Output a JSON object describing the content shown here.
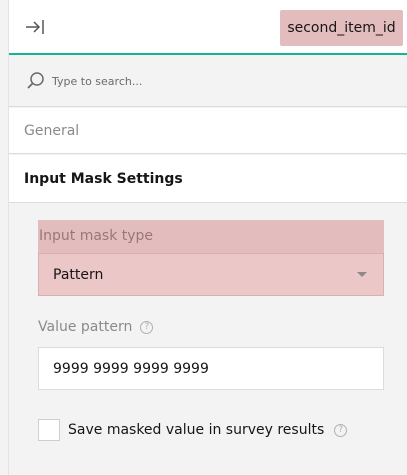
{
  "header": {
    "collapse_icon": "collapse-right-icon",
    "item_name": "second_item_id"
  },
  "search": {
    "icon": "search-icon",
    "placeholder": "Type to search..."
  },
  "categories": {
    "general": "General",
    "input_mask": "Input Mask Settings"
  },
  "mask_type": {
    "label": "Input mask type",
    "value": "Pattern"
  },
  "value_pattern": {
    "label": "Value pattern",
    "value": "9999 9999 9999 9999",
    "help_icon": "question-circle-icon"
  },
  "save_masked": {
    "label": "Save masked value in survey results",
    "checked": false,
    "help_icon": "question-circle-icon"
  },
  "colors": {
    "accent": "#19b394",
    "highlight": "#e3bdbd",
    "background": "#f3f3f3"
  }
}
